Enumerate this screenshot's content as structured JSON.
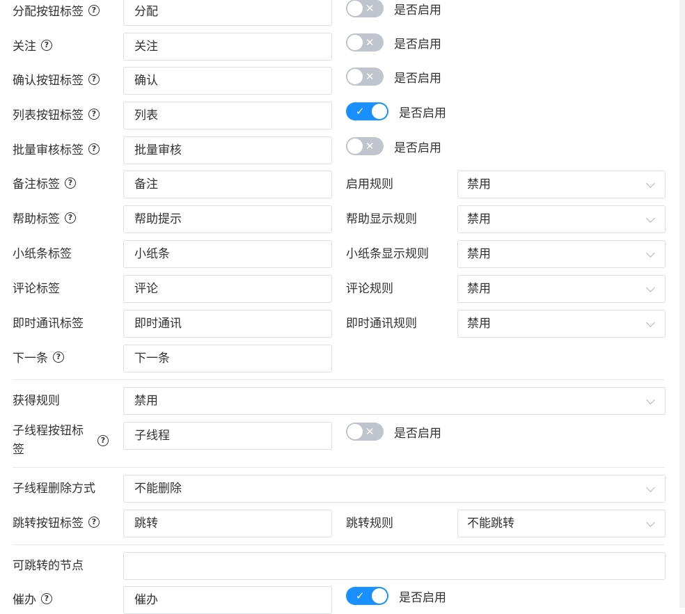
{
  "switch_text": "是否启用",
  "rows": {
    "assign": {
      "label": "分配按钮标签",
      "value": "分配",
      "switch_on": false
    },
    "follow": {
      "label": "关注",
      "value": "关注",
      "switch_on": false
    },
    "confirm": {
      "label": "确认按钮标签",
      "value": "确认",
      "switch_on": false
    },
    "list": {
      "label": "列表按钮标签",
      "value": "列表",
      "switch_on": true
    },
    "batch": {
      "label": "批量审核标签",
      "value": "批量审核",
      "switch_on": false
    },
    "remark": {
      "label": "备注标签",
      "value": "备注",
      "label2": "启用规则",
      "select": "禁用"
    },
    "help": {
      "label": "帮助标签",
      "value": "帮助提示",
      "label2": "帮助显示规则",
      "select": "禁用"
    },
    "note": {
      "label": "小纸条标签",
      "value": "小纸条",
      "label2": "小纸条显示规则",
      "select": "禁用"
    },
    "comment": {
      "label": "评论标签",
      "value": "评论",
      "label2": "评论规则",
      "select": "禁用"
    },
    "im": {
      "label": "即时通讯标签",
      "value": "即时通讯",
      "label2": "即时通讯规则",
      "select": "禁用"
    },
    "next": {
      "label": "下一条",
      "value": "下一条"
    },
    "obtain": {
      "label": "获得规则",
      "select": "禁用"
    },
    "subthread": {
      "label": "子线程按钮标签",
      "value": "子线程",
      "switch_on": false
    },
    "subthread_delete": {
      "label": "子线程删除方式",
      "select": "不能删除"
    },
    "jump": {
      "label": "跳转按钮标签",
      "value": "跳转",
      "label2": "跳转规则",
      "select": "不能跳转"
    },
    "jump_nodes": {
      "label": "可跳转的节点",
      "value": ""
    },
    "urge": {
      "label": "催办",
      "value": "催办",
      "switch_on": true
    }
  },
  "icons": {
    "help": "question-circle-icon",
    "switch_off": "x-mark",
    "switch_on": "check-mark",
    "select": "chevron-down-icon"
  },
  "colors": {
    "switch_on": "#1890ff",
    "switch_off": "#c0c4cc",
    "border": "#dcdfe6",
    "text": "#303133"
  }
}
